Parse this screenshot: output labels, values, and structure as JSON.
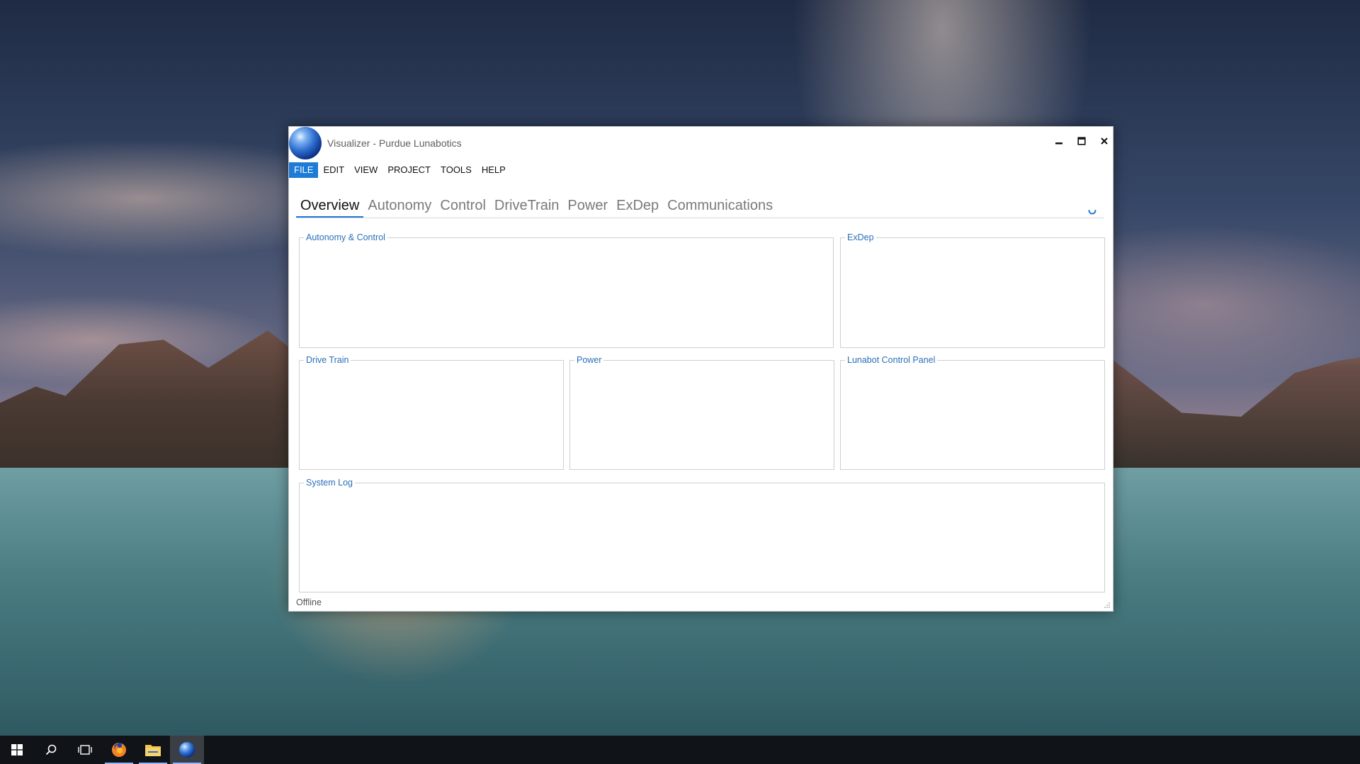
{
  "window": {
    "title": "Visualizer - Purdue Lunabotics",
    "controls": [
      "minimize-icon",
      "maximize-icon",
      "close-icon"
    ]
  },
  "menu": [
    {
      "label": "FILE",
      "active": true
    },
    {
      "label": "EDIT"
    },
    {
      "label": "VIEW"
    },
    {
      "label": "PROJECT"
    },
    {
      "label": "TOOLS"
    },
    {
      "label": "HELP"
    }
  ],
  "tabs": [
    {
      "label": "Overview",
      "active": true
    },
    {
      "label": "Autonomy"
    },
    {
      "label": "Control"
    },
    {
      "label": "DriveTrain"
    },
    {
      "label": "Power"
    },
    {
      "label": "ExDep"
    },
    {
      "label": "Communications"
    }
  ],
  "panels": {
    "autonomy_control": "Autonomy & Control",
    "exdep": "ExDep",
    "drive_train": "Drive Train",
    "power": "Power",
    "lunabot_control_panel": "Lunabot Control Panel",
    "system_log": "System Log"
  },
  "status": "Offline",
  "colors": {
    "accent": "#1e7bd7",
    "panel_label": "#2a6fb8",
    "taskbar": "#101317"
  },
  "taskbar": {
    "items": [
      "windows-start-icon",
      "search-icon",
      "task-view-icon",
      "firefox-icon",
      "file-explorer-icon",
      "visualizer-app-icon"
    ]
  }
}
